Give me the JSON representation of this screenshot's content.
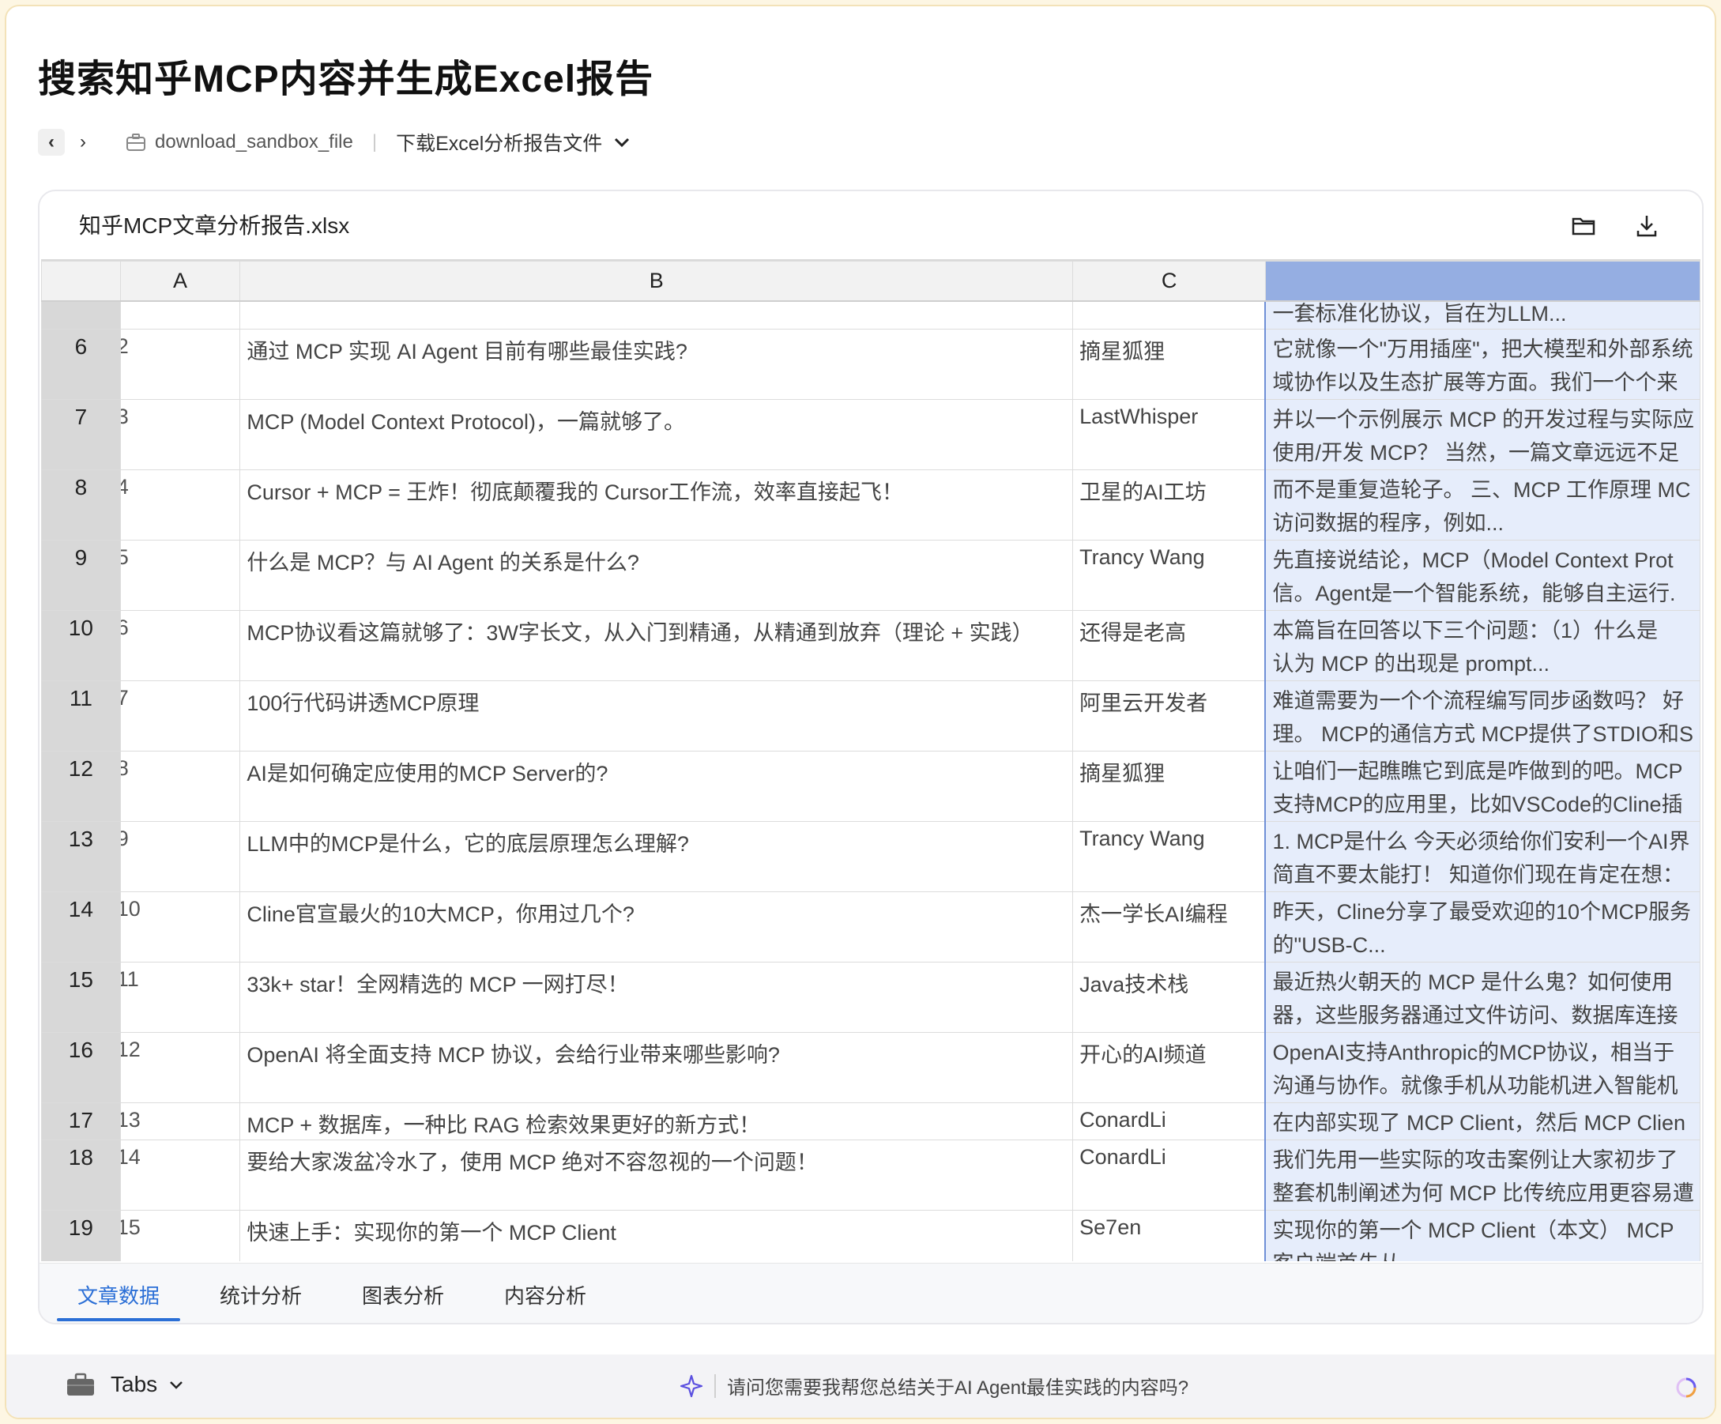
{
  "page": {
    "title": "搜索知乎MCP内容并生成Excel报告"
  },
  "breadcrumb": {
    "prev": "‹",
    "next": "›",
    "tool": "download_sandbox_file",
    "action": "下载Excel分析报告文件"
  },
  "file": {
    "name": "知乎MCP文章分析报告.xlsx"
  },
  "sheet": {
    "columns": [
      "",
      "A",
      "B",
      "C",
      ""
    ],
    "partial_top_row": {
      "D": "一套标准化协议，旨在为LLM..."
    },
    "rows": [
      {
        "rn": "6",
        "A": "2",
        "B": "通过 MCP 实现 AI Agent 目前有哪些最佳实践?",
        "C": "摘星狐狸",
        "D1": "它就像一个\"万用插座\"，把大模型和外部系统",
        "D2": "域协作以及生态扩展等方面。我们一个个来"
      },
      {
        "rn": "7",
        "A": "3",
        "B": "MCP (Model Context Protocol)，一篇就够了。",
        "C": "LastWhisper",
        "D1": "并以一个示例展示 MCP 的开发过程与实际应",
        "D2": "使用/开发 MCP？ 当然，一篇文章远远不足"
      },
      {
        "rn": "8",
        "A": "4",
        "B": "Cursor + MCP = 王炸！彻底颠覆我的 Cursor工作流，效率直接起飞！",
        "C": "卫星的AI工坊",
        "D1": "而不是重复造轮子。 三、MCP 工作原理 MC",
        "D2": "访问数据的程序，例如..."
      },
      {
        "rn": "9",
        "A": "5",
        "B": "什么是 MCP？与 AI Agent 的关系是什么?",
        "C": "Trancy Wang",
        "D1": "先直接说结论，MCP（Model Context Prot",
        "D2": "信。Agent是一个智能系统，能够自主运行."
      },
      {
        "rn": "10",
        "A": "6",
        "B": "MCP协议看这篇就够了：3W字长文，从入门到精通，从精通到放弃（理论 + 实践）",
        "C": "还得是老高",
        "D1": "本篇旨在回答以下三个问题：（1）什么是",
        "D2": "认为 MCP 的出现是 prompt..."
      },
      {
        "rn": "11",
        "A": "7",
        "B": "100行代码讲透MCP原理",
        "C": "阿里云开发者",
        "D1": "难道需要为一个个流程编写同步函数吗？ 好",
        "D2": "理。 MCP的通信方式 MCP提供了STDIO和S"
      },
      {
        "rn": "12",
        "A": "8",
        "B": "AI是如何确定应使用的MCP Server的?",
        "C": "摘星狐狸",
        "D1": "让咱们一起瞧瞧它到底是咋做到的吧。MCP",
        "D2": "支持MCP的应用里，比如VSCode的Cline插"
      },
      {
        "rn": "13",
        "A": "9",
        "B": "LLM中的MCP是什么，它的底层原理怎么理解?",
        "C": "Trancy Wang",
        "D1": "1. MCP是什么 今天必须给你们安利一个AI界",
        "D2": "简直不要太能打！ 知道你们现在肯定在想："
      },
      {
        "rn": "14",
        "A": "10",
        "B": "Cline官宣最火的10大MCP，你用过几个?",
        "C": "杰一学长AI编程",
        "D1": "昨天，Cline分享了最受欢迎的10个MCP服务",
        "D2": "的\"USB-C..."
      },
      {
        "rn": "15",
        "A": "11",
        "B": "33k+ star！全网精选的 MCP 一网打尽！",
        "C": "Java技术栈",
        "D1": "最近热火朝天的 MCP 是什么鬼？如何使用",
        "D2": "器，这些服务器通过文件访问、数据库连接"
      },
      {
        "rn": "16",
        "A": "12",
        "B": "OpenAI 将全面支持 MCP 协议，会给行业带来哪些影响?",
        "C": "开心的AI频道",
        "D1": "OpenAI支持Anthropic的MCP协议，相当于",
        "D2": "沟通与协作。就像手机从功能机进入智能机"
      },
      {
        "rn": "17",
        "A": "13",
        "B": "MCP + 数据库，一种比 RAG 检索效果更好的新方式！",
        "C": "ConardLi",
        "D1": "在内部实现了 MCP Client，然后 MCP Clien",
        "D2": ""
      },
      {
        "rn": "18",
        "A": "14",
        "B": "要给大家泼盆冷水了，使用 MCP 绝对不容忽视的一个问题！",
        "C": "ConardLi",
        "D1": "我们先用一些实际的攻击案例让大家初步了",
        "D2": "整套机制阐述为何 MCP 比传统应用更容易遭"
      },
      {
        "rn": "19",
        "A": "15",
        "B": "快速上手：实现你的第一个 MCP Client",
        "C": "Se7en",
        "D1": "实现你的第一个 MCP Client（本文） MCP",
        "D2": "客户端首先从..."
      }
    ]
  },
  "sheet_tabs": [
    "文章数据",
    "统计分析",
    "图表分析",
    "内容分析"
  ],
  "bottom": {
    "tabs_label": "Tabs",
    "suggestion": "请问您需要我帮您总结关于AI Agent最佳实践的内容吗?"
  },
  "colors": {
    "accent": "#2b6fd6",
    "selected_column_header": "#95aee2",
    "selected_column_fill": "#e6edfb"
  }
}
